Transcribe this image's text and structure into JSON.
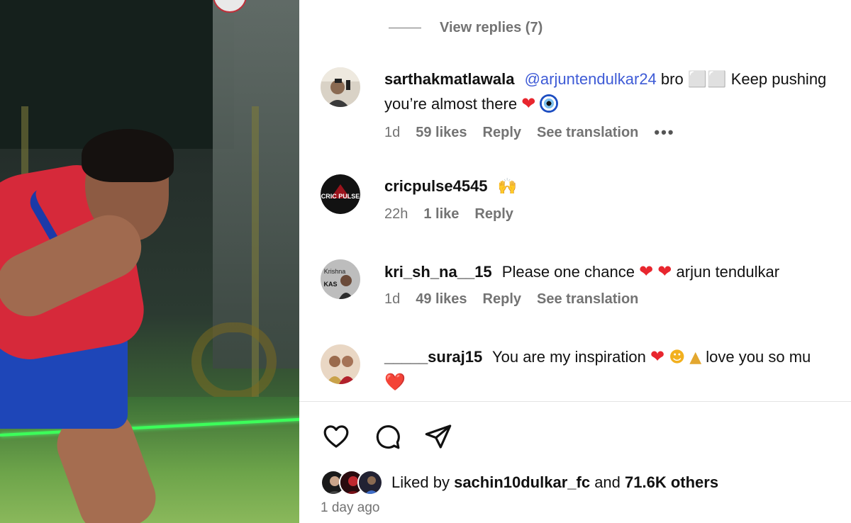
{
  "post": {
    "view_replies": "View replies (7)"
  },
  "comments": [
    {
      "username": "sarthakmatlawala",
      "mention": "@arjuntendulkar24",
      "text_line1": "bro ⬜⬜ Keep pushing",
      "text_line2": "you’re almost there",
      "emoji_suffix": [
        "heart",
        "evil-eye"
      ],
      "time": "1d",
      "likes": "59 likes",
      "reply": "Reply",
      "translation": "See translation",
      "more": "•••"
    },
    {
      "username": "cricpulse4545",
      "text_line1": "🙌",
      "time": "22h",
      "likes": "1 like",
      "reply": "Reply",
      "avatar_text": "CRIC PULSE"
    },
    {
      "username": "kri_sh_na__15",
      "text_line1": "Please one chance",
      "text_after": "arjun tendulkar",
      "time": "1d",
      "likes": "49 likes",
      "reply": "Reply",
      "translation": "See translation",
      "avatar_text": "Krishna KAS"
    },
    {
      "username": "_____suraj15",
      "text_line1": "You are my inspiration",
      "text_after": "love you so mu",
      "text_line2": "❤️"
    }
  ],
  "actions": {
    "like": "heart-icon",
    "comment": "comment-icon",
    "share": "share-icon"
  },
  "likes": {
    "prefix": "Liked by",
    "user": "sachin10dulkar_fc",
    "middle": "and",
    "others": "71.6K others"
  },
  "time_ago": "1 day ago",
  "colors": {
    "mention": "#3e5bd6",
    "meta": "#737373",
    "heart": "#e8262e"
  }
}
